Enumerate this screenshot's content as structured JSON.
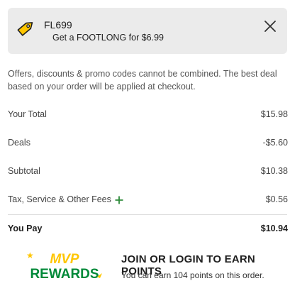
{
  "promo": {
    "code": "FL699",
    "description": "Get a FOOTLONG for $6.99",
    "icon": "tag-icon",
    "close_icon": "close-icon"
  },
  "disclaimer": "Offers, discounts & promo codes cannot be combined. The best deal based on your order will be applied at checkout.",
  "summary": {
    "your_total_label": "Your Total",
    "your_total_value": "$15.98",
    "deals_label": "Deals",
    "deals_value": "-$5.60",
    "subtotal_label": "Subtotal",
    "subtotal_value": "$10.38",
    "fees_label": "Tax, Service & Other Fees",
    "fees_value": "$0.56",
    "you_pay_label": "You Pay",
    "you_pay_value": "$10.94"
  },
  "rewards": {
    "logo_top": "MVP",
    "logo_bottom": "REWARDS",
    "heading": "JOIN OR LOGIN TO EARN POINTS",
    "subtext": "You can earn 104 points on this order."
  },
  "colors": {
    "card_bg": "#ebebeb",
    "accent_yellow": "#ffc600",
    "accent_green": "#008938",
    "plus_green": "#2e8b3a"
  }
}
